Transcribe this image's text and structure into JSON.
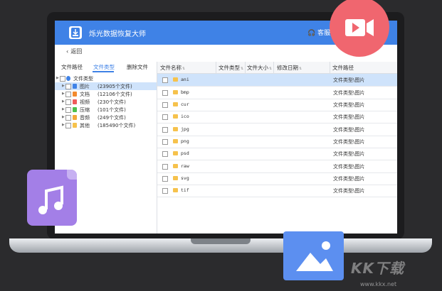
{
  "app": {
    "title": "烁光数据恢复大师",
    "service_label": "客服"
  },
  "nav": {
    "back_label": "返回"
  },
  "left_tabs": [
    {
      "label": "文件路径"
    },
    {
      "label": "文件类型",
      "active": true
    },
    {
      "label": "删除文件"
    }
  ],
  "tree": {
    "root": "文件类型",
    "items": [
      {
        "label": "图片",
        "count": "(23905个文件)",
        "color": "#3f82e6",
        "selected": true
      },
      {
        "label": "文档",
        "count": "(12106个文件)",
        "color": "#f28a2e"
      },
      {
        "label": "视频",
        "count": "(230个文件)",
        "color": "#ef5b5b"
      },
      {
        "label": "压缩",
        "count": "(101个文件)",
        "color": "#4cbf4c"
      },
      {
        "label": "音频",
        "count": "(249个文件)",
        "color": "#f2a93b"
      },
      {
        "label": "其他",
        "count": "(185490个文件)",
        "color": "#f6c24c"
      }
    ]
  },
  "table": {
    "headers": [
      "文件名称",
      "文件类型",
      "文件大小",
      "修改日期",
      "文件路径"
    ],
    "rows": [
      {
        "name": "ani",
        "path": "文件类型\\图片"
      },
      {
        "name": "bmp",
        "path": "文件类型\\图片"
      },
      {
        "name": "cur",
        "path": "文件类型\\图片"
      },
      {
        "name": "ico",
        "path": "文件类型\\图片"
      },
      {
        "name": "jpg",
        "path": "文件类型\\图片"
      },
      {
        "name": "png",
        "path": "文件类型\\图片"
      },
      {
        "name": "psd",
        "path": "文件类型\\图片"
      },
      {
        "name": "raw",
        "path": "文件类型\\图片"
      },
      {
        "name": "svg",
        "path": "文件类型\\图片"
      },
      {
        "name": "tif",
        "path": "文件类型\\图片"
      }
    ]
  },
  "watermark": {
    "text": "KK下载",
    "url": "www.kkx.net"
  },
  "colors": {
    "accent": "#3f82e6",
    "selection": "#cfe3fb",
    "video_badge": "#f0666f",
    "music_card": "#a37fe7",
    "image_card": "#5c8ff0"
  }
}
